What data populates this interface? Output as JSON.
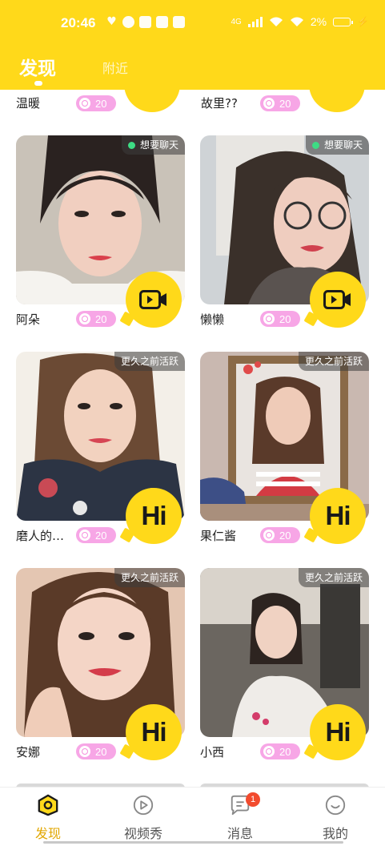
{
  "status_bar": {
    "time": "20:46",
    "network": "4G",
    "battery": "2%"
  },
  "tabs": [
    {
      "label": "发现",
      "active": true
    },
    {
      "label": "附近",
      "active": false
    }
  ],
  "partial_row": [
    {
      "name": "温暖",
      "level": "20"
    },
    {
      "name": "故里??",
      "level": "20"
    }
  ],
  "cards": [
    {
      "name": "阿朵",
      "level": "20",
      "status": "想要聊天",
      "online": true,
      "action": "video-call-icon"
    },
    {
      "name": "懒懒",
      "level": "20",
      "status": "想要聊天",
      "online": true,
      "action": "video-call-icon"
    },
    {
      "name": "磨人的…",
      "level": "20",
      "status": "更久之前活跃",
      "online": false,
      "action": "Hi"
    },
    {
      "name": "果仁酱",
      "level": "20",
      "status": "更久之前活跃",
      "online": false,
      "action": "Hi"
    },
    {
      "name": "安娜",
      "level": "20",
      "status": "更久之前活跃",
      "online": false,
      "action": "Hi"
    },
    {
      "name": "小西",
      "level": "20",
      "status": "更久之前活跃",
      "online": false,
      "action": "Hi"
    }
  ],
  "nav": [
    {
      "label": "发现",
      "icon": "discover-icon",
      "active": true
    },
    {
      "label": "视频秀",
      "icon": "video-show-icon",
      "active": false
    },
    {
      "label": "消息",
      "icon": "message-icon",
      "active": false,
      "badge": "1"
    },
    {
      "label": "我的",
      "icon": "profile-icon",
      "active": false
    }
  ],
  "colors": {
    "brand_yellow": "#FFD91A",
    "level_pill": "#F7A6E6",
    "online_dot": "#3DDC84",
    "badge_red": "#F24B2E",
    "active_nav": "#E2A700"
  }
}
